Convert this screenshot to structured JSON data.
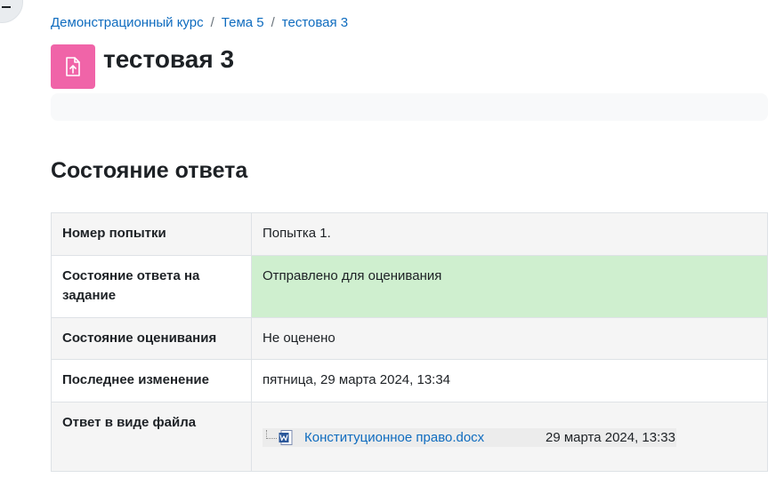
{
  "breadcrumb": {
    "items": [
      "Демонстрационный курс",
      "Тема 5",
      "тестовая 3"
    ],
    "separator": "/"
  },
  "header": {
    "title": "тестовая 3",
    "icon": "assignment-upload-icon",
    "icon_color": "#f064a8"
  },
  "submission_status": {
    "heading": "Состояние ответа",
    "rows": [
      {
        "label": "Номер попытки",
        "value": "Попытка 1."
      },
      {
        "label": "Состояние ответа на задание",
        "value": "Отправлено для оценивания",
        "highlight": "#cfefcf"
      },
      {
        "label": "Состояние оценивания",
        "value": "Не оценено"
      },
      {
        "label": "Последнее изменение",
        "value": "пятница, 29 марта 2024, 13:34"
      },
      {
        "label": "Ответ в виде файла",
        "file": {
          "name": "Конституционное право.docx",
          "date": "29 марта 2024, 13:33",
          "icon": "word-document-icon"
        }
      }
    ]
  },
  "colors": {
    "link": "#0f6cbf",
    "text": "#1d2125"
  }
}
